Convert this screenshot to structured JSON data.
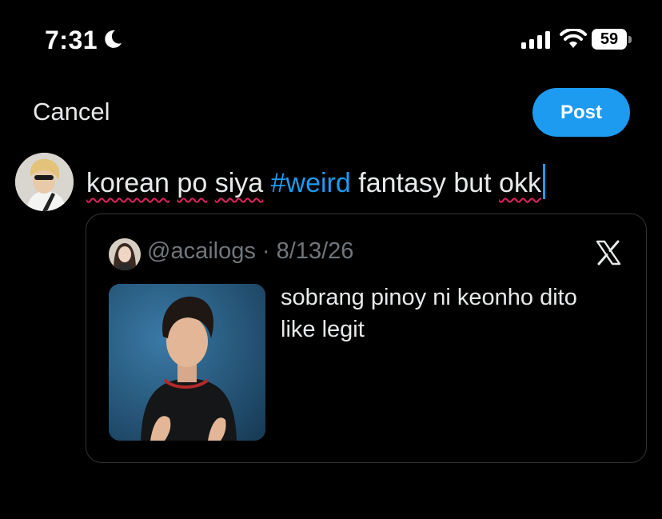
{
  "status_bar": {
    "time": "7:31",
    "battery": "59"
  },
  "header": {
    "cancel_label": "Cancel",
    "post_label": "Post"
  },
  "compose": {
    "words": [
      "korean",
      "po",
      "siya",
      "#weird",
      "fantasy but",
      "okk"
    ]
  },
  "quote": {
    "handle": "@acailogs",
    "separator": "·",
    "date": "8/13/26",
    "text_line1": "sobrang pinoy ni keonho dito",
    "text_line2": "like legit"
  },
  "colors": {
    "accent": "#1d9bf0",
    "background": "#000000",
    "muted": "#71767b",
    "border": "#2f3336",
    "spellcheck": "#e0245e"
  },
  "icons": {
    "status": [
      "moon-icon",
      "signal-icon",
      "wifi-icon",
      "battery-icon"
    ],
    "quote": "x-logo-icon"
  }
}
